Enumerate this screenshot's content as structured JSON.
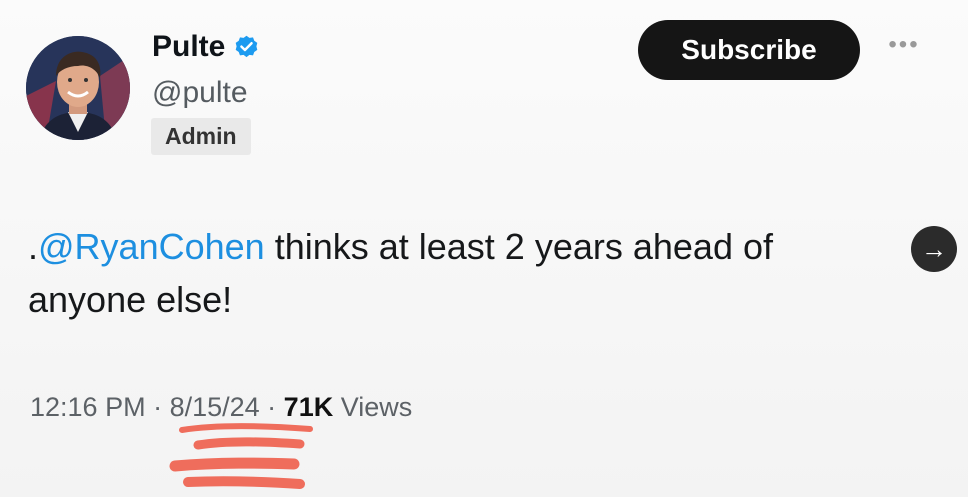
{
  "author": {
    "display_name": "Pulte",
    "handle": "@pulte",
    "role_badge": "Admin",
    "verified": true,
    "verified_color": "#1d9bf0"
  },
  "actions": {
    "subscribe_label": "Subscribe",
    "more_label": "•••",
    "open_icon": "→"
  },
  "tweet": {
    "prefix": ".",
    "mention": "@RyanCohen",
    "text_rest": " thinks at least 2 years ahead of anyone else!",
    "mention_color": "#1d8fe0"
  },
  "meta": {
    "time": "12:16 PM",
    "sep1": " · ",
    "date": "8/15/24",
    "sep2": " · ",
    "views_count": "71K",
    "views_label": " Views"
  },
  "annotation_color": "#ef6d5c"
}
